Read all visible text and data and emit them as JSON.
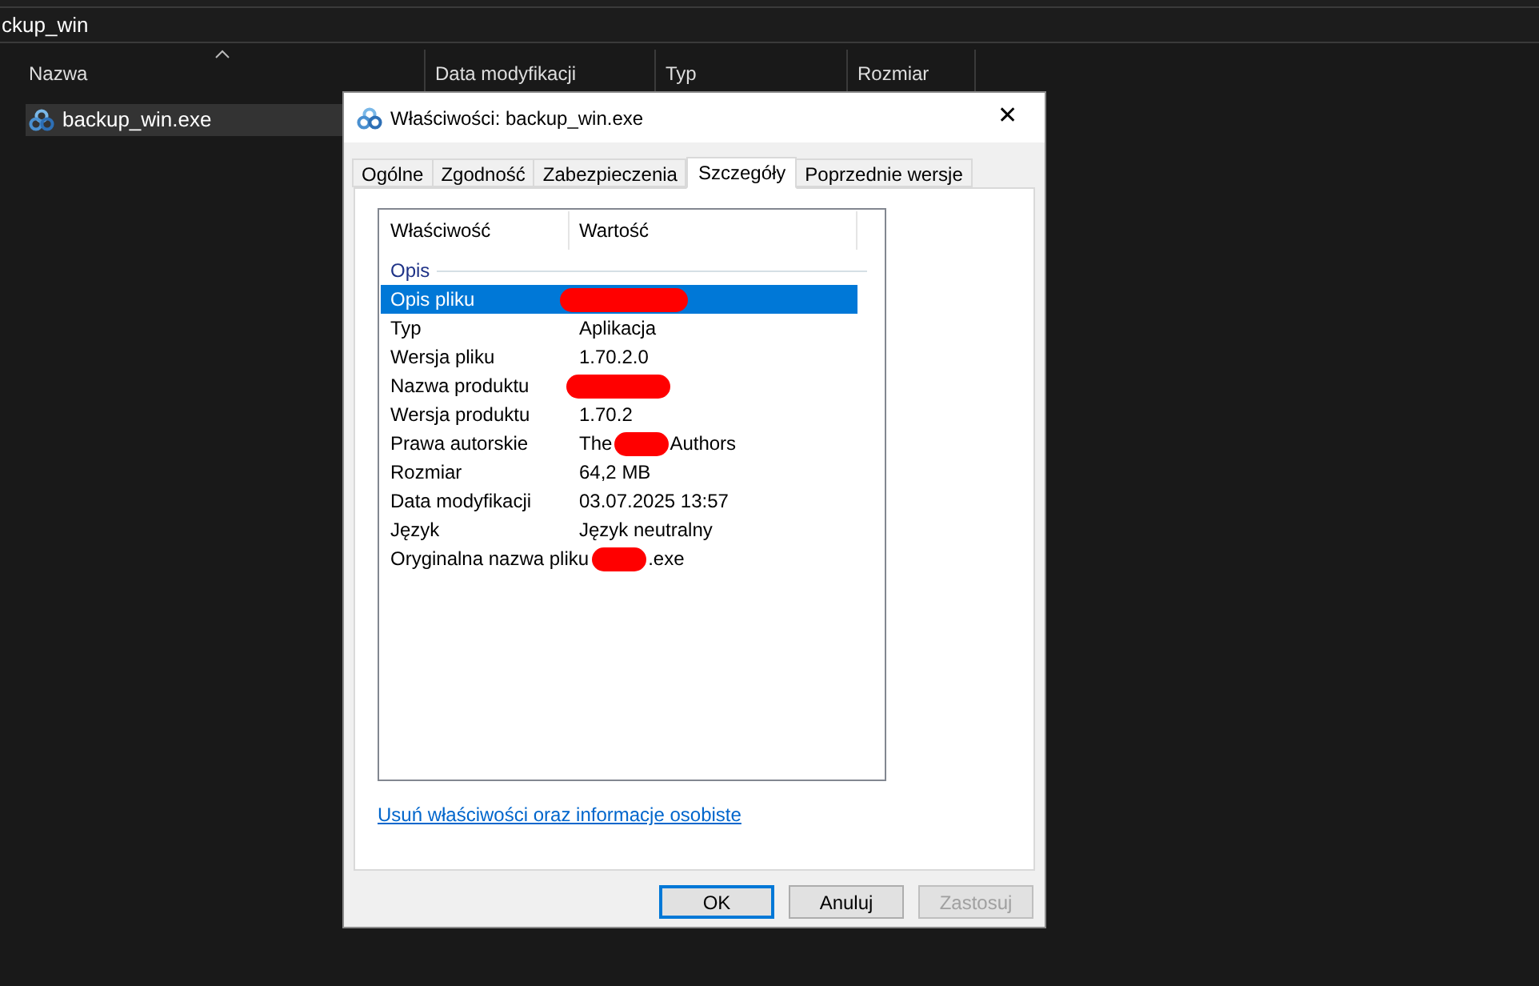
{
  "explorer": {
    "address": "ckup_win",
    "columns": [
      {
        "label": "Nazwa",
        "sorted": true
      },
      {
        "label": "Data modyfikacji",
        "sorted": false
      },
      {
        "label": "Typ",
        "sorted": false
      },
      {
        "label": "Rozmiar",
        "sorted": false
      }
    ],
    "files": [
      {
        "name": "backup_win.exe",
        "selected": true
      }
    ]
  },
  "dialog": {
    "title": "Właściwości: backup_win.exe",
    "close": "✕",
    "tabs": [
      {
        "label": "Ogólne",
        "selected": false
      },
      {
        "label": "Zgodność",
        "selected": false
      },
      {
        "label": "Zabezpieczenia",
        "selected": false
      },
      {
        "label": "Szczegóły",
        "selected": true
      },
      {
        "label": "Poprzednie wersje",
        "selected": false
      }
    ],
    "list_columns": [
      "Właściwość",
      "Wartość"
    ],
    "group": "Opis",
    "rows": [
      {
        "property": "Opis pliku",
        "selected": true,
        "value_parts": [
          {
            "kind": "redaction"
          }
        ]
      },
      {
        "property": "Typ",
        "selected": false,
        "value_parts": [
          {
            "kind": "text",
            "text": "Aplikacja"
          }
        ]
      },
      {
        "property": "Wersja pliku",
        "selected": false,
        "value_parts": [
          {
            "kind": "text",
            "text": "1.70.2.0"
          }
        ]
      },
      {
        "property": "Nazwa produktu",
        "selected": false,
        "value_parts": [
          {
            "kind": "redaction"
          }
        ]
      },
      {
        "property": "Wersja produktu",
        "selected": false,
        "value_parts": [
          {
            "kind": "text",
            "text": "1.70.2"
          }
        ]
      },
      {
        "property": "Prawa autorskie",
        "selected": false,
        "value_parts": [
          {
            "kind": "text",
            "text": "The"
          },
          {
            "kind": "redaction"
          },
          {
            "kind": "text",
            "text": "Authors"
          }
        ]
      },
      {
        "property": "Rozmiar",
        "selected": false,
        "value_parts": [
          {
            "kind": "text",
            "text": "64,2 MB"
          }
        ]
      },
      {
        "property": "Data modyfikacji",
        "selected": false,
        "value_parts": [
          {
            "kind": "text",
            "text": "03.07.2025 13:57"
          }
        ]
      },
      {
        "property": "Język",
        "selected": false,
        "value_parts": [
          {
            "kind": "text",
            "text": "Język neutralny"
          }
        ]
      },
      {
        "property": "Oryginalna nazwa pliku",
        "selected": false,
        "value_parts": [
          {
            "kind": "redaction"
          },
          {
            "kind": "text",
            "text": ".exe"
          }
        ]
      }
    ],
    "link": "Usuń właściwości oraz informacje osobiste",
    "buttons": [
      {
        "label": "OK",
        "kind": "default",
        "disabled": false
      },
      {
        "label": "Anuluj",
        "kind": "normal",
        "disabled": false
      },
      {
        "label": "Zastosuj",
        "kind": "normal",
        "disabled": true
      }
    ]
  }
}
